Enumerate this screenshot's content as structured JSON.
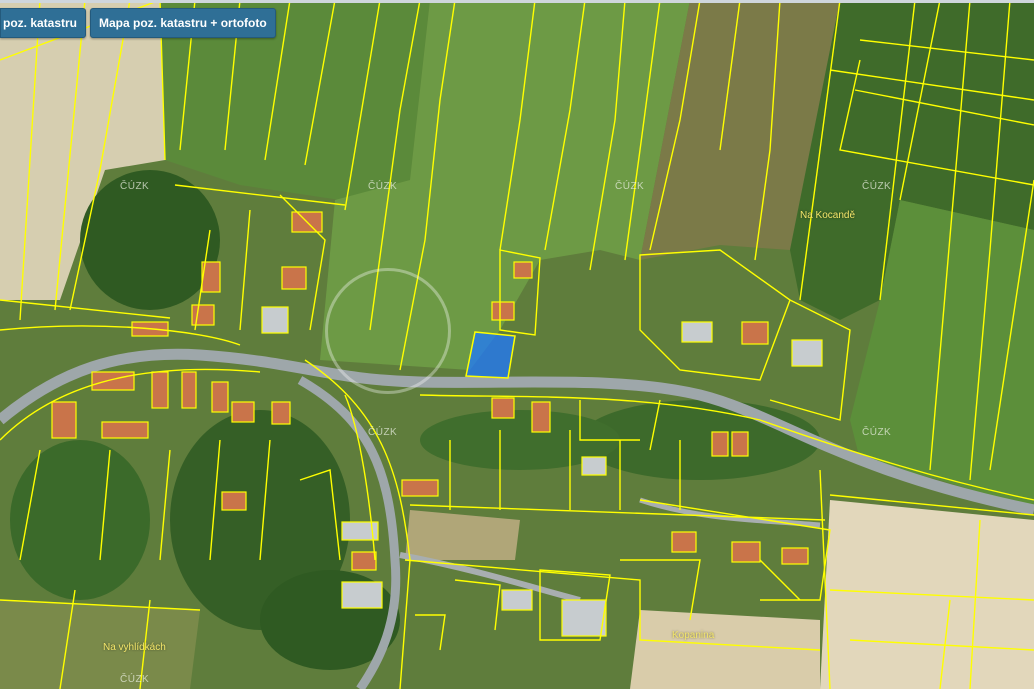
{
  "toolbar": {
    "tab_cadastre": "poz. katastru",
    "tab_cadastre_orthophoto": "Mapa poz. katastru + ortofoto"
  },
  "map": {
    "place_labels": [
      "Na Kocandě",
      "Na vyhlídkách",
      "Kopanina"
    ],
    "watermark_labels": [
      "ČÚZK",
      "ČÚZK",
      "ČÚZK",
      "ČÚZK",
      "ČÚZK",
      "ČÚZK",
      "ČÚZK"
    ],
    "colors": {
      "parcel_boundary": "#ffff00",
      "selected_parcel": "#1e78ff",
      "road": "#9aa3a6",
      "field_green": "#4f7a2e",
      "field_light": "#d8cfae",
      "tab_bg": "#2f6f96"
    },
    "icons": [
      "map-watermark-logo-icon"
    ]
  }
}
